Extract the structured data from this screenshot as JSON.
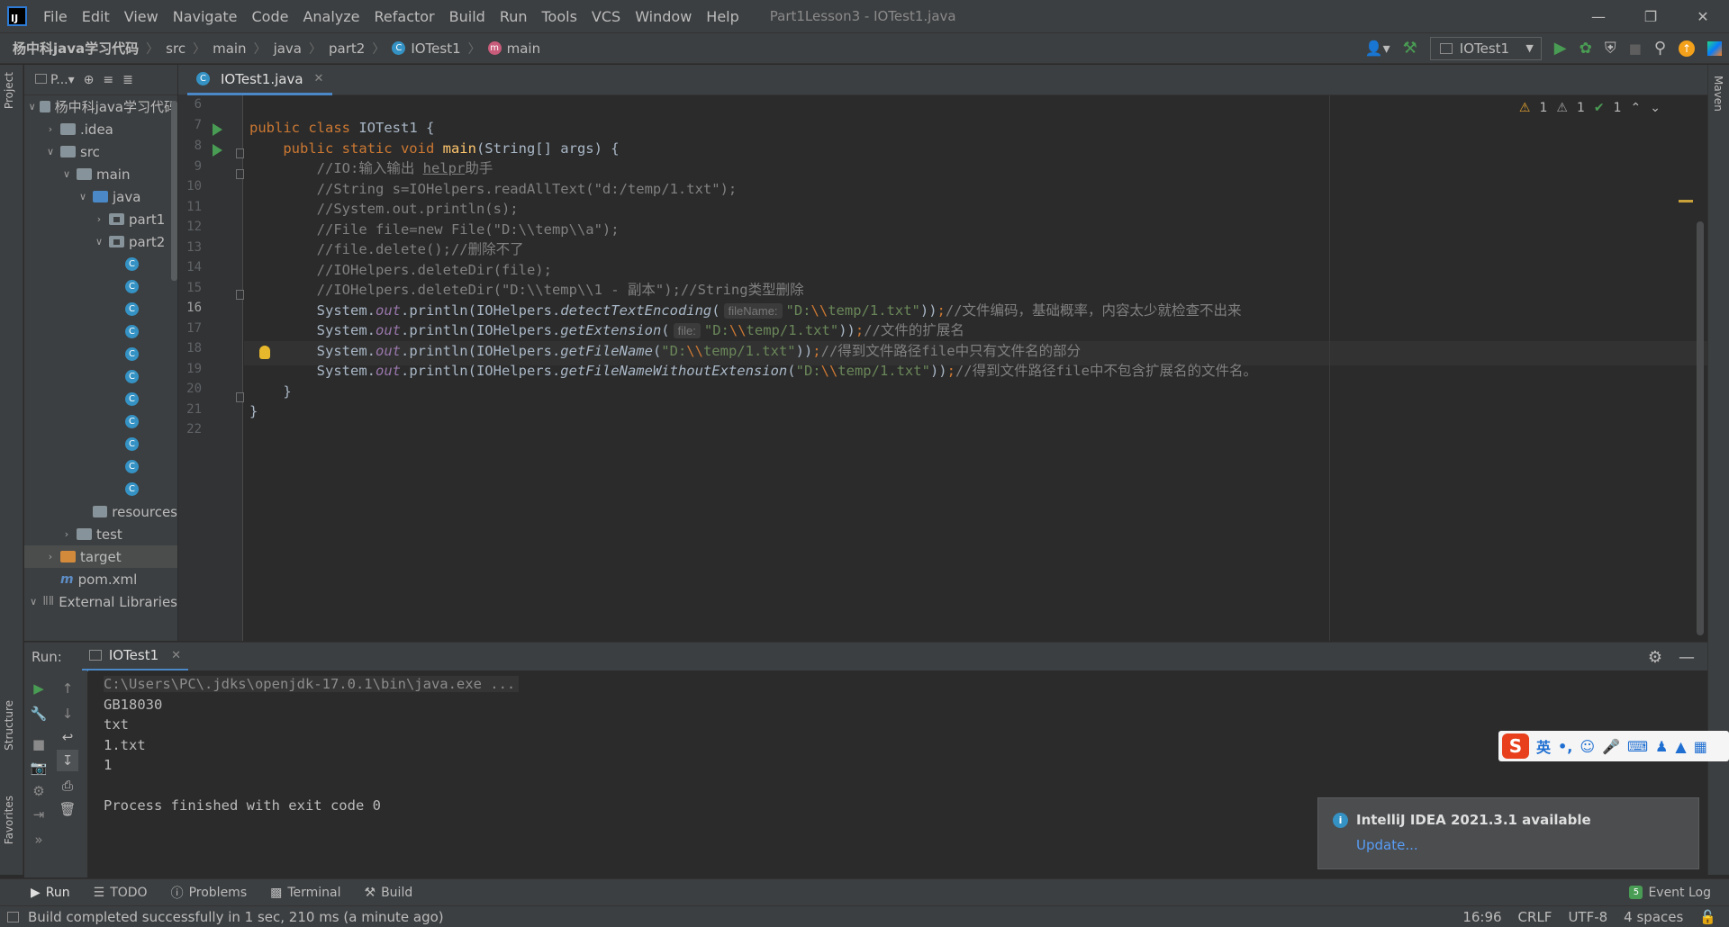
{
  "menubar": {
    "items": [
      "File",
      "Edit",
      "View",
      "Navigate",
      "Code",
      "Analyze",
      "Refactor",
      "Build",
      "Run",
      "Tools",
      "VCS",
      "Window",
      "Help"
    ],
    "window_title": "Part1Lesson3 - IOTest1.java",
    "logo": "IJ"
  },
  "breadcrumb": {
    "project": "杨中科java学习代码",
    "items": [
      "src",
      "main",
      "java",
      "part2",
      "IOTest1",
      "main"
    ]
  },
  "toolbar": {
    "run_config": "IOTest1"
  },
  "sidebar": {
    "left_tabs": [
      "Project",
      "Structure",
      "Favorites"
    ],
    "right_tabs": [
      "Maven"
    ]
  },
  "project": {
    "header": "P...",
    "tree": [
      {
        "label": "杨中科java学习代码",
        "type": "root",
        "arrow": "v"
      },
      {
        "label": ".idea",
        "type": "folder",
        "arrow": ">"
      },
      {
        "label": "src",
        "type": "folder",
        "arrow": "v"
      },
      {
        "label": "main",
        "type": "folder",
        "arrow": "v"
      },
      {
        "label": "java",
        "type": "src",
        "arrow": "v"
      },
      {
        "label": "part1",
        "type": "pkg",
        "arrow": ">"
      },
      {
        "label": "part2",
        "type": "pkg",
        "arrow": "v"
      },
      {
        "label": "",
        "type": "class"
      },
      {
        "label": "",
        "type": "class"
      },
      {
        "label": "",
        "type": "class"
      },
      {
        "label": "",
        "type": "class"
      },
      {
        "label": "",
        "type": "class"
      },
      {
        "label": "",
        "type": "class"
      },
      {
        "label": "",
        "type": "class"
      },
      {
        "label": "",
        "type": "class"
      },
      {
        "label": "",
        "type": "class"
      },
      {
        "label": "",
        "type": "class"
      },
      {
        "label": "",
        "type": "class"
      },
      {
        "label": "resources",
        "type": "folder"
      },
      {
        "label": "test",
        "type": "folder",
        "arrow": ">"
      },
      {
        "label": "target",
        "type": "orange",
        "arrow": ">"
      },
      {
        "label": "pom.xml",
        "type": "maven"
      },
      {
        "label": "External Libraries",
        "type": "lib",
        "arrow": "v"
      }
    ]
  },
  "editor": {
    "tab_label": "IOTest1.java",
    "inspections": {
      "warnings_a": "1",
      "warnings_b": "1",
      "ok": "1"
    },
    "line_numbers": [
      "6",
      "7",
      "8",
      "9",
      "10",
      "11",
      "12",
      "13",
      "14",
      "15",
      "16",
      "17",
      "18",
      "19",
      "20",
      "21",
      "22"
    ],
    "current_line": "16",
    "hint_filename": "fileName:",
    "hint_file": "file:"
  },
  "run": {
    "label": "Run:",
    "tab": "IOTest1",
    "console": [
      "C:\\Users\\PC\\.jdks\\openjdk-17.0.1\\bin\\java.exe ...",
      "GB18030",
      "txt",
      "1.txt",
      "1",
      "",
      "Process finished with exit code 0"
    ]
  },
  "ime": {
    "mode": "英"
  },
  "notification": {
    "title": "IntelliJ IDEA 2021.3.1 available",
    "link": "Update..."
  },
  "tool_tabs": [
    "Run",
    "TODO",
    "Problems",
    "Terminal",
    "Build"
  ],
  "event_log": {
    "label": "Event Log",
    "count": "5"
  },
  "status": {
    "message": "Build completed successfully in 1 sec, 210 ms (a minute ago)",
    "position": "16:96",
    "line_sep": "CRLF",
    "encoding": "UTF-8",
    "indent": "4 spaces"
  },
  "colors": {
    "background": "#2b2b2b",
    "panel": "#3c3f41",
    "keyword": "#cc7832",
    "string": "#6a8759",
    "comment": "#808080",
    "method": "#ffc66d",
    "static_field": "#9876aa",
    "accent": "#4a88c7"
  }
}
